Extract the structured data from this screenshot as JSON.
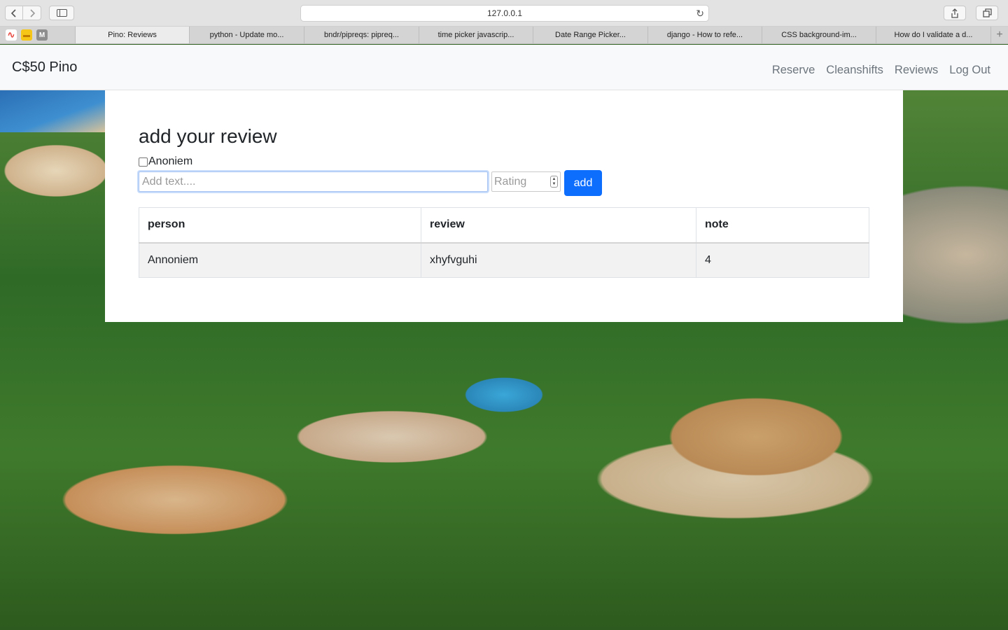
{
  "browser": {
    "url": "127.0.0.1",
    "tabs": [
      {
        "label": "Pino: Reviews",
        "active": true
      },
      {
        "label": "python - Update mo...",
        "active": false
      },
      {
        "label": "bndr/pipreqs: pipreq...",
        "active": false
      },
      {
        "label": "time picker javascrip...",
        "active": false
      },
      {
        "label": "Date Range Picker...",
        "active": false
      },
      {
        "label": "django - How to refe...",
        "active": false
      },
      {
        "label": "CSS background-im...",
        "active": false
      },
      {
        "label": "How do I validate a d...",
        "active": false
      }
    ],
    "favorites": [
      {
        "icon": "rainbow-icon",
        "color": "#e8453c",
        "glyph": "∿"
      },
      {
        "icon": "yellow-bookmark-icon",
        "color": "#f5c518",
        "glyph": "▬"
      },
      {
        "icon": "m-icon",
        "color": "#8e8e8e",
        "glyph": "M"
      }
    ]
  },
  "navbar": {
    "brand": "C$50 Pino",
    "links": [
      "Reserve",
      "Cleanshifts",
      "Reviews",
      "Log Out"
    ]
  },
  "review_form": {
    "title": "add your review",
    "anon_label": "Anoniem",
    "anon_checked": false,
    "text_placeholder": "Add text....",
    "text_value": "",
    "rating_placeholder": "Rating",
    "rating_value": "",
    "submit_label": "add"
  },
  "reviews_table": {
    "headers": [
      "person",
      "review",
      "note"
    ],
    "rows": [
      [
        "Annoniem",
        "xhyfvguhi",
        "4"
      ]
    ]
  }
}
